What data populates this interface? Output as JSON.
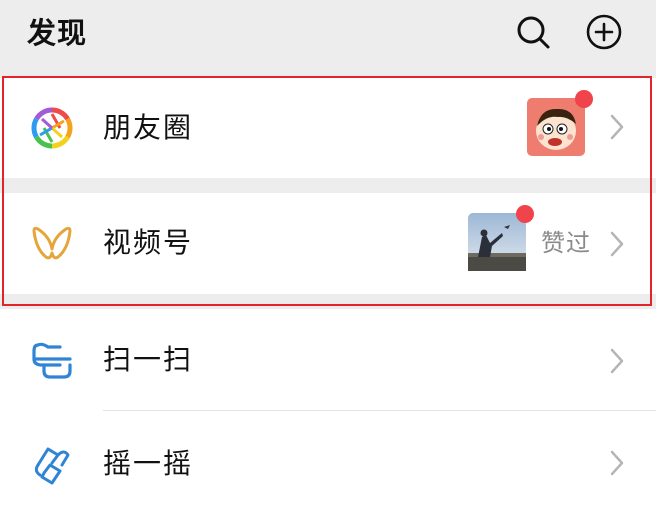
{
  "header": {
    "title": "发现",
    "search_icon": "search-icon",
    "add_icon": "plus-circle-icon"
  },
  "items": [
    {
      "label": "朋友圈",
      "icon": "moments-aperture-icon",
      "thumb": "cartoon-boy-avatar",
      "has_red_dot": true
    },
    {
      "label": "视频号",
      "icon": "channels-icon",
      "thumb": "video-thumbnail",
      "has_red_dot": true,
      "status": "赞过"
    },
    {
      "label": "扫一扫",
      "icon": "scan-icon"
    },
    {
      "label": "摇一摇",
      "icon": "shake-icon"
    }
  ],
  "colors": {
    "background": "#ededed",
    "row": "#ffffff",
    "highlight_border": "#e0262a",
    "red_dot": "#f0434b",
    "channels_icon": "#e6a53a",
    "scan_shake_icon": "#2f84d6"
  }
}
